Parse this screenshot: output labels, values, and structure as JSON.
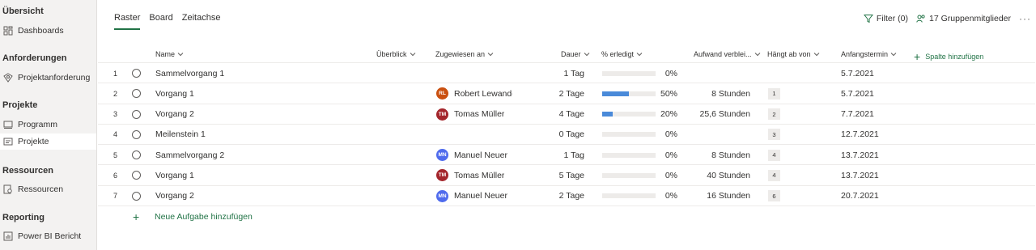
{
  "sidebar": {
    "sections": [
      {
        "title": "Übersicht",
        "items": [
          {
            "label": "Dashboards",
            "icon": "dashboard-icon"
          }
        ]
      },
      {
        "title": "Anforderungen",
        "items": [
          {
            "label": "Projektanforderung",
            "icon": "request-icon"
          }
        ]
      },
      {
        "title": "Projekte",
        "items": [
          {
            "label": "Programm",
            "icon": "program-icon"
          },
          {
            "label": "Projekte",
            "icon": "projects-icon",
            "active": true
          }
        ]
      },
      {
        "title": "Ressourcen",
        "items": [
          {
            "label": "Ressourcen",
            "icon": "resources-icon"
          }
        ]
      },
      {
        "title": "Reporting",
        "items": [
          {
            "label": "Power BI Bericht",
            "icon": "report-icon"
          }
        ]
      }
    ]
  },
  "tabs": [
    "Raster",
    "Board",
    "Zeitachse"
  ],
  "active_tab": "Raster",
  "toolbar": {
    "filter": "Filter (0)",
    "members": "17 Gruppenmitglieder",
    "more": "···"
  },
  "columns": {
    "name": "Name",
    "overview": "Überblick",
    "assigned": "Zugewiesen an",
    "duration": "Dauer",
    "percent": "% erledigt",
    "effort": "Aufwand verblei...",
    "depends": "Hängt ab von",
    "start": "Anfangstermin",
    "add_column": "Spalte hinzufügen"
  },
  "rows": [
    {
      "num": "1",
      "name": "Sammelvorgang 1",
      "assignee": "",
      "initials": "",
      "avatar_color": "",
      "duration": "1 Tag",
      "percent_value": 0,
      "percent": "0%",
      "effort": "",
      "depends": "",
      "start": "5.7.2021"
    },
    {
      "num": "2",
      "name": "Vorgang 1",
      "assignee": "Robert Lewandow",
      "initials": "RL",
      "avatar_color": "#ca5010",
      "duration": "2 Tage",
      "percent_value": 50,
      "percent": "50%",
      "effort": "8 Stunden",
      "depends": "1",
      "start": "5.7.2021"
    },
    {
      "num": "3",
      "name": "Vorgang 2",
      "assignee": "Tomas Müller",
      "initials": "TM",
      "avatar_color": "#a4262c",
      "duration": "4 Tage",
      "percent_value": 20,
      "percent": "20%",
      "effort": "25,6 Stunden",
      "depends": "2",
      "start": "7.7.2021"
    },
    {
      "num": "4",
      "name": "Meilenstein 1",
      "assignee": "",
      "initials": "",
      "avatar_color": "",
      "duration": "0 Tage",
      "percent_value": 0,
      "percent": "0%",
      "effort": "",
      "depends": "3",
      "start": "12.7.2021"
    },
    {
      "num": "5",
      "name": "Sammelvorgang 2",
      "assignee": "Manuel Neuer",
      "initials": "MN",
      "avatar_color": "#4f6bed",
      "duration": "1 Tag",
      "percent_value": 0,
      "percent": "0%",
      "effort": "8 Stunden",
      "depends": "4",
      "start": "13.7.2021"
    },
    {
      "num": "6",
      "name": "Vorgang 1",
      "assignee": "Tomas Müller",
      "initials": "TM",
      "avatar_color": "#a4262c",
      "duration": "5 Tage",
      "percent_value": 0,
      "percent": "0%",
      "effort": "40 Stunden",
      "depends": "4",
      "start": "13.7.2021"
    },
    {
      "num": "7",
      "name": "Vorgang 2",
      "assignee": "Manuel Neuer",
      "initials": "MN",
      "avatar_color": "#4f6bed",
      "duration": "2 Tage",
      "percent_value": 0,
      "percent": "0%",
      "effort": "16 Stunden",
      "depends": "6",
      "start": "20.7.2021"
    }
  ],
  "add_task": "Neue Aufgabe hinzufügen",
  "colors": {
    "accent": "#217346",
    "progress": "#4a8ad9",
    "sidebar_bg": "#f3f2f1"
  }
}
